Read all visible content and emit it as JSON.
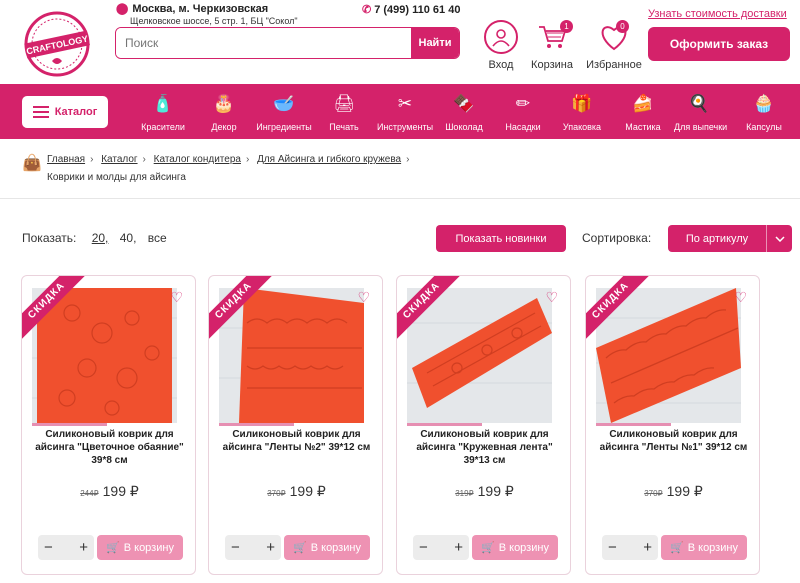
{
  "header": {
    "logo_text": "CRAFTOLOGY",
    "location": "Москва, м. Черкизовская",
    "address": "Щелковское шоссе, 5 стр. 1, БЦ \"Сокол\"",
    "phone": "7 (499) 110 61 40",
    "delivery_link": "Узнать стоимость доставки",
    "search_placeholder": "Поиск",
    "search_button": "Найти",
    "login_label": "Вход",
    "cart_label": "Корзина",
    "cart_count": "1",
    "favorites_label": "Избранное",
    "favorites_count": "0",
    "order_button": "Оформить заказ"
  },
  "catalog_bar": {
    "catalog_button": "Каталог",
    "items": [
      {
        "label": "Красители",
        "icon": "dye-bottle-icon"
      },
      {
        "label": "Декор",
        "icon": "decor-icon"
      },
      {
        "label": "Ингредиенты",
        "icon": "ingredients-bowl-icon"
      },
      {
        "label": "Печать",
        "icon": "printer-icon"
      },
      {
        "label": "Инструменты",
        "icon": "tools-icon"
      },
      {
        "label": "Шоколад",
        "icon": "chocolate-icon"
      },
      {
        "label": "Насадки",
        "icon": "piping-nozzle-icon"
      },
      {
        "label": "Упаковка",
        "icon": "gift-box-icon"
      },
      {
        "label": "Мастика",
        "icon": "cake-icon"
      },
      {
        "label": "Для выпечки",
        "icon": "baking-pan-icon"
      },
      {
        "label": "Капсулы",
        "icon": "cupcake-icon"
      }
    ]
  },
  "breadcrumbs": {
    "links": [
      "Главная",
      "Каталог",
      "Каталог кондитера",
      "Для Айсинга и гибкого кружева"
    ],
    "current": "Коврики и молды для айсинга"
  },
  "toolbar": {
    "show_label": "Показать:",
    "show_options": [
      "20,",
      "40,",
      "все"
    ],
    "new_button": "Показать новинки",
    "sort_label": "Сортировка:",
    "sort_value": "По артикулу"
  },
  "products": [
    {
      "badge": "СКИДКА",
      "title": "Силиконовый коврик для айсинга \"Цветочное обаяние\" 39*8 см",
      "old_price": "244₽",
      "price": "199 ₽",
      "cart_button": "В корзину"
    },
    {
      "badge": "СКИДКА",
      "title": "Силиконовый коврик для айсинга \"Ленты №2\" 39*12 см",
      "old_price": "370₽",
      "price": "199 ₽",
      "cart_button": "В корзину"
    },
    {
      "badge": "СКИДКА",
      "title": "Силиконовый коврик для айсинга \"Кружевная лента\" 39*13 см",
      "old_price": "319₽",
      "price": "199 ₽",
      "cart_button": "В корзину"
    },
    {
      "badge": "СКИДКА",
      "title": "Силиконовый коврик для айсинга \"Ленты №1\" 39*12 см",
      "old_price": "370₽",
      "price": "199 ₽",
      "cart_button": "В корзину"
    }
  ],
  "colors": {
    "accent": "#d4226a",
    "mat": "#f0502e"
  }
}
